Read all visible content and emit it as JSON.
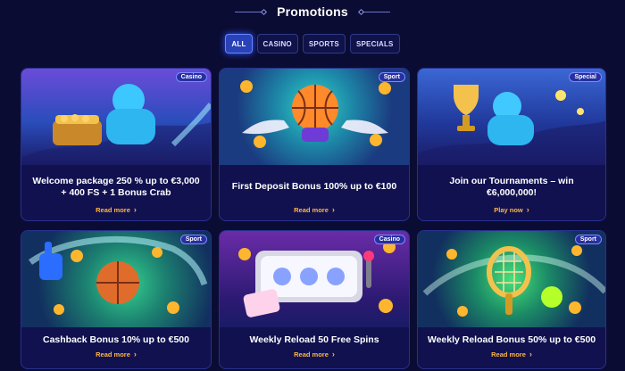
{
  "page": {
    "title": "Promotions"
  },
  "filters": [
    {
      "label": "ALL",
      "active": true
    },
    {
      "label": "CASINO",
      "active": false
    },
    {
      "label": "SPORTS",
      "active": false
    },
    {
      "label": "SPECIALS",
      "active": false
    }
  ],
  "cards": [
    {
      "badge": "Casino",
      "title": "Welcome package 250 % up to €3,000 + 400 FS + 1 Bonus Crab",
      "cta": "Read more"
    },
    {
      "badge": "Sport",
      "title": "First Deposit Bonus 100% up to €100",
      "cta": "Read more"
    },
    {
      "badge": "Special",
      "title": "Join our Tournaments – win €6,000,000!",
      "cta": "Play now"
    },
    {
      "badge": "Sport",
      "title": "Cashback Bonus 10% up to €500",
      "cta": "Read more"
    },
    {
      "badge": "Casino",
      "title": "Weekly Reload 50 Free Spins",
      "cta": "Read more"
    },
    {
      "badge": "Sport",
      "title": "Weekly Reload Bonus 50% up to €500",
      "cta": "Read more"
    }
  ]
}
